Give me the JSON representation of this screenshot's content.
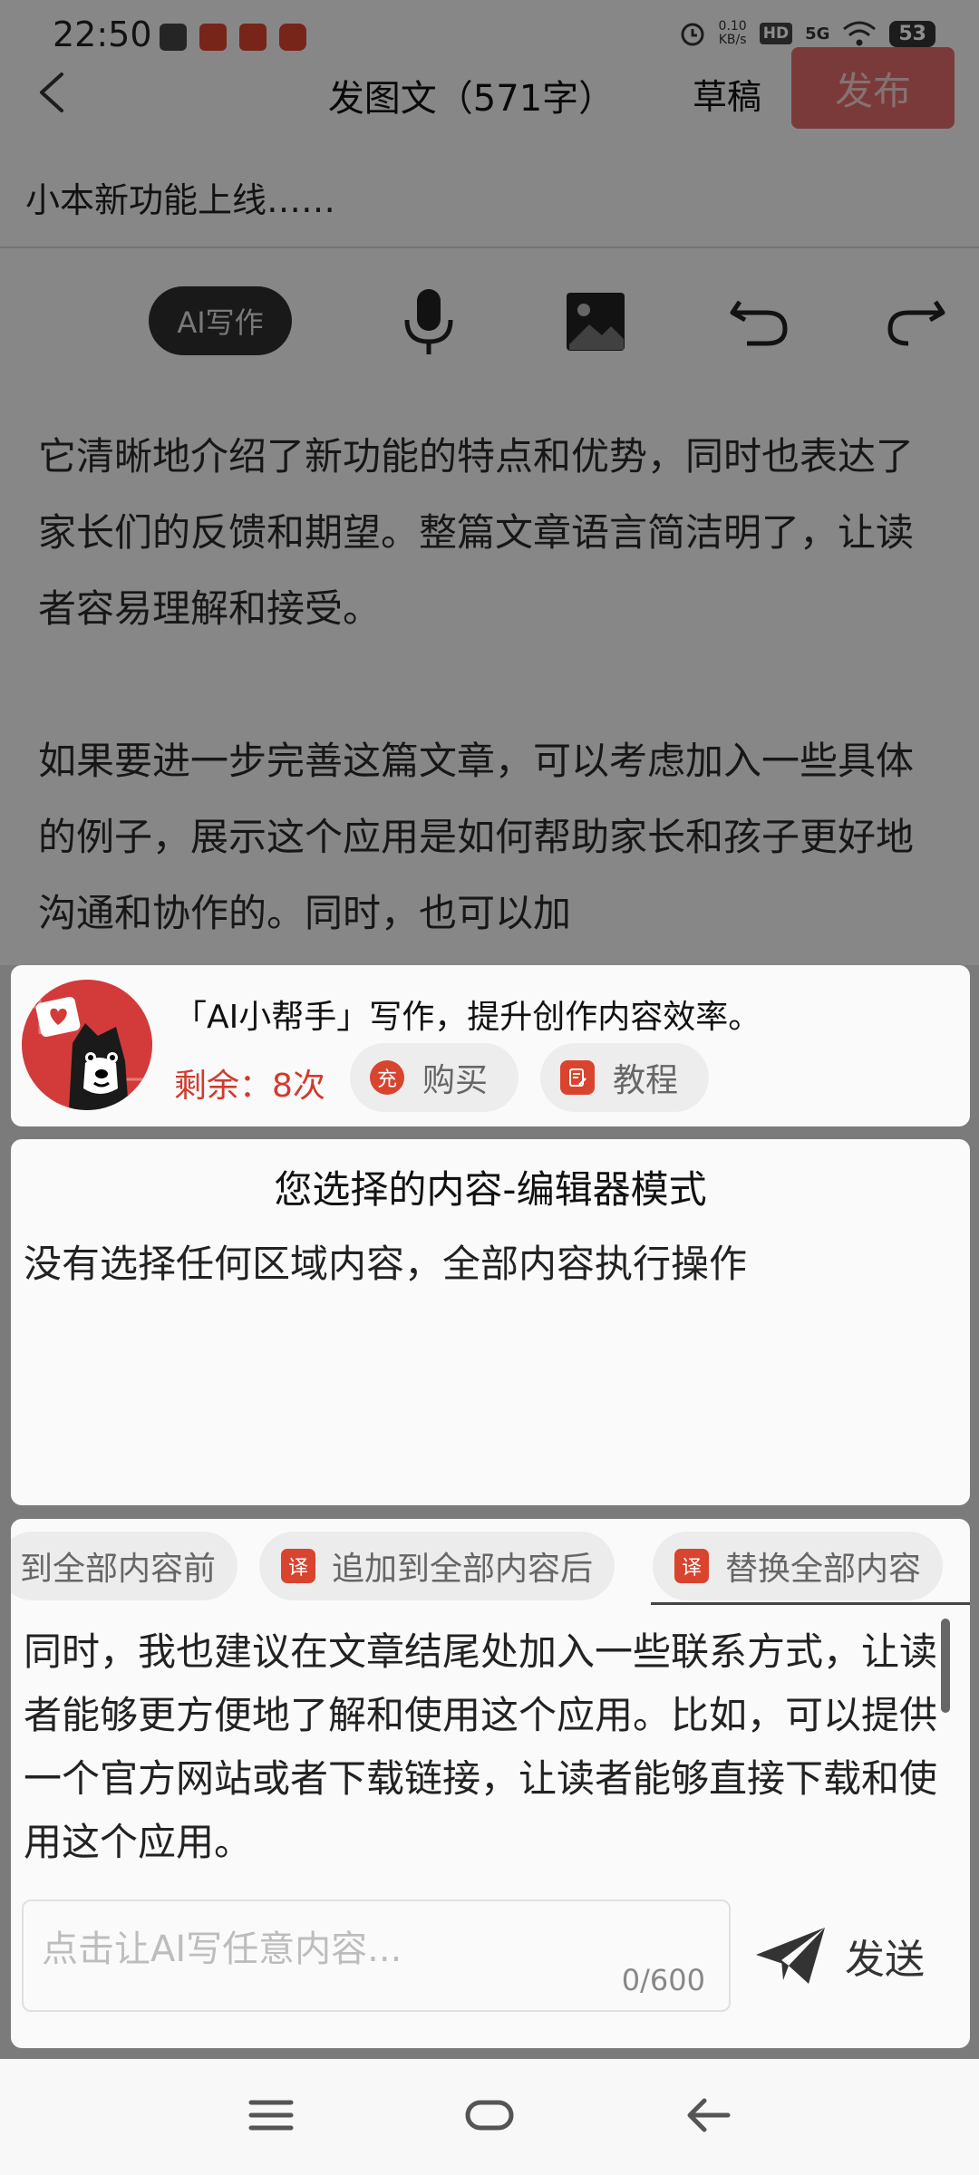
{
  "status_bar": {
    "time": "22:50",
    "net_speed_value": "0.10",
    "net_speed_unit": "KB/s",
    "hd": "HD",
    "signal": "5G",
    "battery": "53"
  },
  "header": {
    "title": "发图文（571字）",
    "draft_label": "草稿",
    "publish_label": "发布"
  },
  "editor": {
    "post_title": "小本新功能上线……",
    "ai_write_label": "AI写作",
    "paragraphs": [
      "它清晰地介绍了新功能的特点和优势，同时也表达了家长们的反馈和期望。整篇文章语言简洁明了，让读者容易理解和接受。",
      "如果要进一步完善这篇文章，可以考虑加入一些具体的例子，展示这个应用是如何帮助家长和孩子更好地沟通和协作的。同时，也可以加"
    ]
  },
  "ai_panel": {
    "slogan": "「AI小帮手」写作，提升创作内容效率。",
    "remaining": "剩余：8次",
    "buy_icon_text": "充",
    "buy_label": "购买",
    "tutorial_label": "教程",
    "selection_title": "您选择的内容-编辑器模式",
    "selection_desc": "没有选择任何区域内容，全部内容执行操作",
    "actions": [
      {
        "icon_text": "",
        "label": "到全部内容前"
      },
      {
        "icon_text": "译",
        "label": "追加到全部内容后"
      },
      {
        "icon_text": "译",
        "label": "替换全部内容"
      }
    ],
    "result_text": "同时，我也建议在文章结尾处加入一些联系方式，让读者能够更方便地了解和使用这个应用。比如，可以提供一个官方网站或者下载链接，让读者能够直接下载和使用这个应用。",
    "prompt_placeholder": "点击让AI写任意内容...",
    "prompt_count": "0/600",
    "send_label": "发送"
  },
  "colors": {
    "accent_red": "#d9442f",
    "publish_bg": "#e06a6a",
    "remaining_text": "#d23a2e"
  }
}
